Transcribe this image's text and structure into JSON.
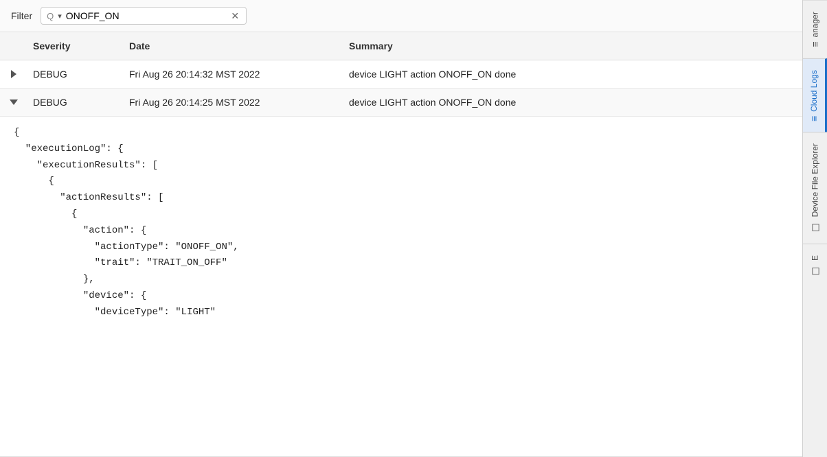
{
  "filter": {
    "label": "Filter",
    "icon": "🔍",
    "value": "ONOFF_ON",
    "placeholder": "Filter logs..."
  },
  "table": {
    "headers": {
      "expand": "",
      "severity": "Severity",
      "date": "Date",
      "summary": "Summary"
    },
    "rows": [
      {
        "id": "row-1",
        "severity": "DEBUG",
        "date": "Fri Aug 26 20:14:32 MST 2022",
        "summary": "device LIGHT action ONOFF_ON done",
        "expanded": false
      },
      {
        "id": "row-2",
        "severity": "DEBUG",
        "date": "Fri Aug 26 20:14:25 MST 2022",
        "summary": "device LIGHT action ONOFF_ON done",
        "expanded": true
      }
    ]
  },
  "json_content": [
    "{",
    "  \"executionLog\": {",
    "    \"executionResults\": [",
    "      {",
    "        \"actionResults\": [",
    "          {",
    "            \"action\": {",
    "              \"actionType\": \"ONOFF_ON\",",
    "              \"trait\": \"TRAIT_ON_OFF\"",
    "            },",
    "            \"device\": {",
    "              \"deviceType\": \"LIGHT\""
  ],
  "sidebar": {
    "tabs": [
      {
        "id": "manager",
        "label": "anager",
        "icon": "≡",
        "active": false
      },
      {
        "id": "cloud-logs",
        "label": "Cloud Logs",
        "icon": "≡",
        "active": true
      },
      {
        "id": "device-file-explorer",
        "label": "Device File Explorer",
        "icon": "☐",
        "active": false
      },
      {
        "id": "extra",
        "label": "E",
        "icon": "☐",
        "active": false
      }
    ]
  }
}
